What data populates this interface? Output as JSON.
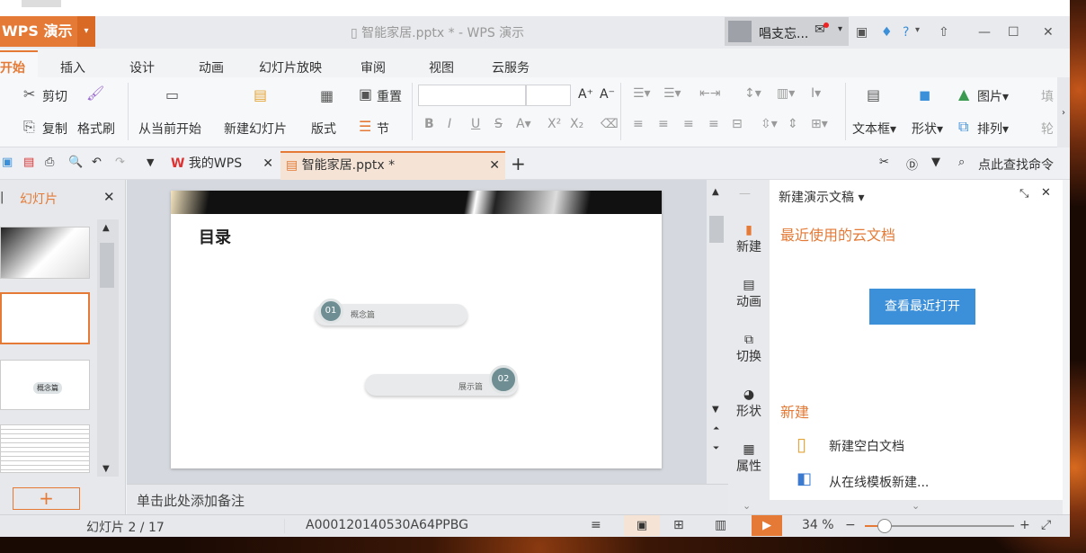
{
  "window": {
    "app_button": "WPS 演示",
    "title": "智能家居.pptx * - WPS 演示",
    "user_name": "唱支忘..."
  },
  "menu": [
    "开始",
    "插入",
    "设计",
    "动画",
    "幻灯片放映",
    "审阅",
    "视图",
    "云服务"
  ],
  "ribbon": {
    "cut": "剪切",
    "copy": "复制",
    "format_painter": "格式刷",
    "from_current": "从当前开始",
    "new_slide": "新建幻灯片",
    "layout": "版式",
    "reset": "重置",
    "section": "节",
    "text_box": "文本框",
    "shape": "形状",
    "picture": "图片",
    "arrange": "排列",
    "fill": "填",
    "outline": "轮"
  },
  "tabs": {
    "my_wps": "我的WPS",
    "doc": "智能家居.pptx *"
  },
  "search_cmd": "点此查找命令",
  "left_pane": {
    "title": "幻灯片",
    "add": "+"
  },
  "slide": {
    "heading": "目录",
    "item1_num": "01",
    "item1_label": "概念篇",
    "item2_num": "02",
    "item2_label": "展示篇"
  },
  "thumb3_label": "概念篇",
  "notes_placeholder": "单击此处添加备注",
  "side_tabs": [
    "新建",
    "动画",
    "切换",
    "形状",
    "属性"
  ],
  "task_pane": {
    "header": "新建演示文稿",
    "recent_title": "最近使用的云文档",
    "recent_button": "查看最近打开",
    "new_title": "新建",
    "new_blank": "新建空白文档",
    "from_online": "从在线模板新建..."
  },
  "status": {
    "slide_counter": "幻灯片 2 / 17",
    "doc_id": "A000120140530A64PPBG",
    "zoom": "34 %"
  },
  "colors": {
    "accent": "#e57a36",
    "blue_button": "#3c8fd9",
    "chip": "#6e8e94"
  }
}
